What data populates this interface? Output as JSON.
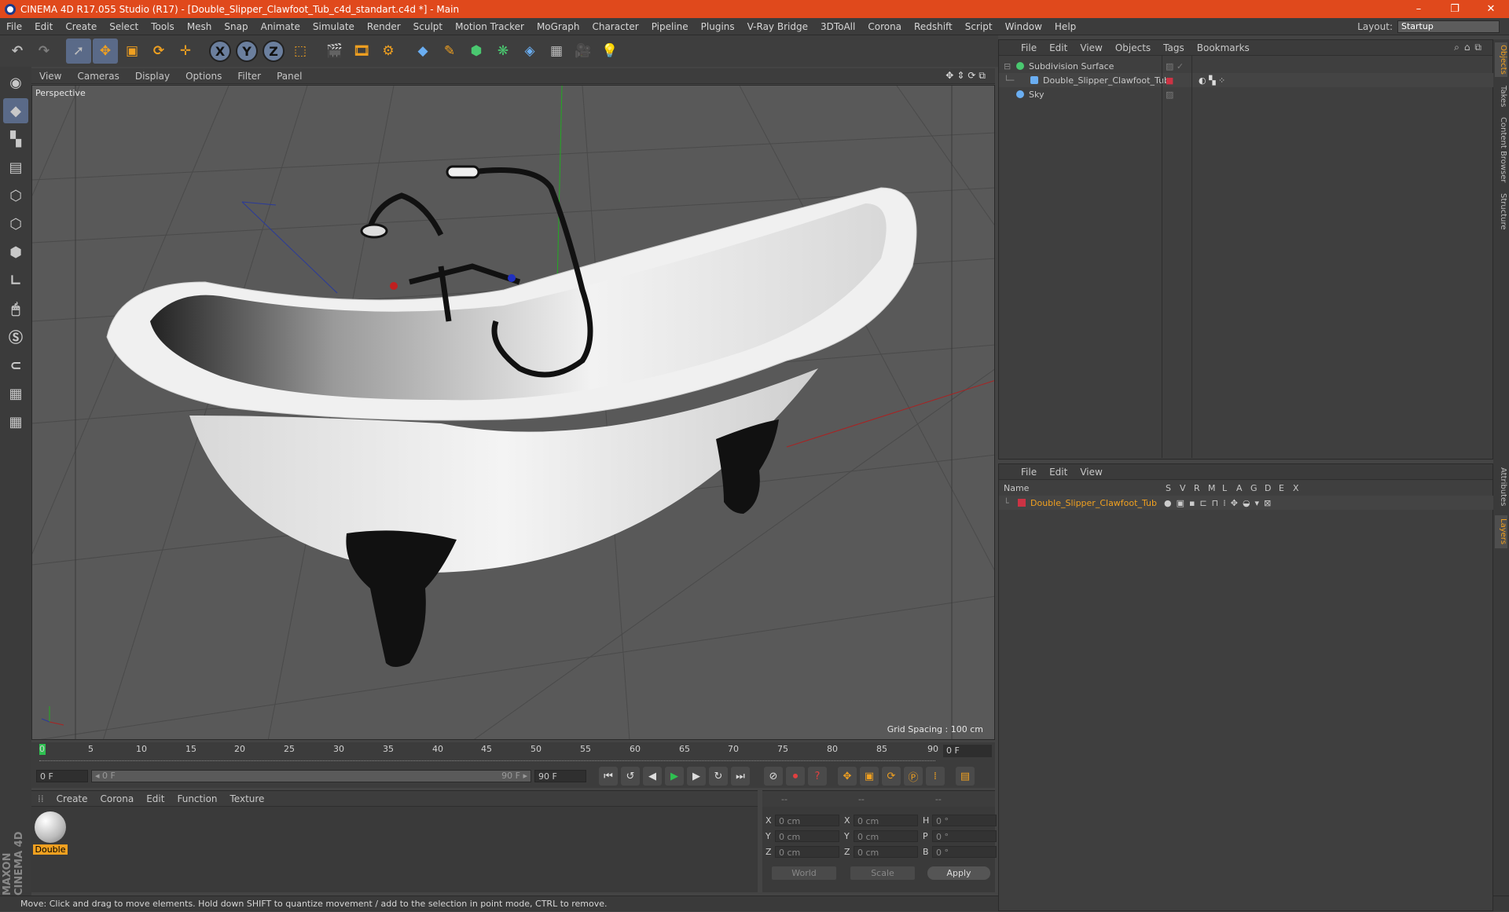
{
  "window": {
    "title": "CINEMA 4D R17.055 Studio (R17) - [Double_Slipper_Clawfoot_Tub_c4d_standart.c4d *] - Main",
    "controls": [
      "–",
      "❐",
      "✕"
    ]
  },
  "menubar": {
    "items": [
      "File",
      "Edit",
      "Create",
      "Select",
      "Tools",
      "Mesh",
      "Snap",
      "Animate",
      "Simulate",
      "Render",
      "Sculpt",
      "Motion Tracker",
      "MoGraph",
      "Character",
      "Pipeline",
      "Plugins",
      "V-Ray Bridge",
      "3DToAll",
      "Corona",
      "Redshift",
      "Script",
      "Window",
      "Help"
    ],
    "layout_label": "Layout:",
    "layout_value": "Startup"
  },
  "toolbar": {
    "undo": "↶",
    "redo": "↷",
    "xyz": [
      "X",
      "Y",
      "Z"
    ]
  },
  "viewport": {
    "menu": [
      "View",
      "Cameras",
      "Display",
      "Options",
      "Filter",
      "Panel"
    ],
    "label": "Perspective",
    "grid_spacing": "Grid Spacing : 100 cm",
    "nav_icons": "✥⇕⟳⧉"
  },
  "timeline": {
    "ticks": [
      "0",
      "5",
      "10",
      "15",
      "20",
      "25",
      "30",
      "35",
      "40",
      "45",
      "50",
      "55",
      "60",
      "65",
      "70",
      "75",
      "80",
      "85",
      "90"
    ],
    "current_frame": "0 F"
  },
  "transport": {
    "start": "0 F",
    "range_start": "◂ 0 F",
    "range_end": "90 F ▸",
    "end": "90 F"
  },
  "material_panel": {
    "menu": [
      "Create",
      "Corona",
      "Edit",
      "Function",
      "Texture"
    ],
    "material_name": "Double"
  },
  "coord_panel": {
    "headers": [
      "--",
      "--",
      "--"
    ],
    "rows": [
      {
        "a": "X",
        "av": "0 cm",
        "b": "X",
        "bv": "0 cm",
        "c": "H",
        "cv": "0 °"
      },
      {
        "a": "Y",
        "av": "0 cm",
        "b": "Y",
        "bv": "0 cm",
        "c": "P",
        "cv": "0 °"
      },
      {
        "a": "Z",
        "av": "0 cm",
        "b": "Z",
        "bv": "0 cm",
        "c": "B",
        "cv": "0 °"
      }
    ],
    "world": "World",
    "scale": "Scale",
    "apply": "Apply"
  },
  "object_manager": {
    "menu": [
      "File",
      "Edit",
      "View",
      "Objects",
      "Tags",
      "Bookmarks"
    ],
    "objects": [
      {
        "name": "Subdivision Surface",
        "color": "#4ac870"
      },
      {
        "name": "Double_Slipper_Clawfoot_Tub",
        "color": "#6aaef2"
      },
      {
        "name": "Sky",
        "color": "#6aaef2"
      }
    ]
  },
  "layer_manager": {
    "menu": [
      "File",
      "Edit",
      "View"
    ],
    "columns": [
      "Name",
      "S",
      "V",
      "R",
      "M",
      "L",
      "A",
      "G",
      "D",
      "E",
      "X"
    ],
    "layers": [
      {
        "name": "Double_Slipper_Clawfoot_Tub",
        "color": "#cc3344"
      }
    ]
  },
  "right_tabs": [
    "Objects",
    "Takes",
    "Content Browser",
    "Structure",
    "Attributes",
    "Layers"
  ],
  "status": "Move: Click and drag to move elements. Hold down SHIFT to quantize movement / add to the selection in point mode, CTRL to remove.",
  "brand": "MAXON CINEMA 4D",
  "colors": {
    "title_bar": "#e0491c",
    "accent": "#f0a020",
    "selected_tool": "#5a6a88"
  }
}
